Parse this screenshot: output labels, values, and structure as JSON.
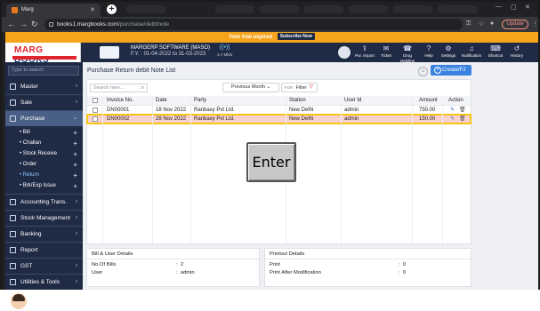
{
  "browser": {
    "tab_title": "Marg",
    "url_host": "books1.margbooks.com",
    "url_path": "/purchase/debitnote",
    "update_label": "Update"
  },
  "trial": {
    "text": "Your trial expired",
    "subscribe_label": "Subscribe Now"
  },
  "brand": {
    "logo_text_1": "MARG",
    "logo_text_2": "BOOKS"
  },
  "company": {
    "name": "MARGERP SOFTWARE (MASO)",
    "fy": "F.Y. : 01-04-2022 to 31-03-2023",
    "speed": "4.7 Mb/s"
  },
  "header_items": [
    {
      "label": "Pur. Import",
      "icon": "upload-icon"
    },
    {
      "label": "Ticket",
      "icon": "ticket-icon"
    },
    {
      "label": "Drug Helpline",
      "icon": "phone-icon"
    },
    {
      "label": "Help",
      "icon": "help-icon"
    },
    {
      "label": "Settings",
      "icon": "gear-icon"
    },
    {
      "label": "Notification",
      "icon": "bell-icon"
    },
    {
      "label": "Shortcut",
      "icon": "keyboard-icon"
    },
    {
      "label": "History",
      "icon": "history-icon"
    }
  ],
  "sidebar": {
    "search_placeholder": "Type to search",
    "items": [
      {
        "label": "Master"
      },
      {
        "label": "Sale"
      },
      {
        "label": "Purchase"
      },
      {
        "label": "Accounting Trans."
      },
      {
        "label": "Stock Management"
      },
      {
        "label": "Banking"
      },
      {
        "label": "Report"
      },
      {
        "label": "GST"
      },
      {
        "label": "Utilities & Tools"
      }
    ],
    "sub_items": [
      {
        "label": "Bill"
      },
      {
        "label": "Challan"
      },
      {
        "label": "Stock Receive"
      },
      {
        "label": "Order"
      },
      {
        "label": "Return"
      },
      {
        "label": "Brk/Exp Issue"
      }
    ]
  },
  "main": {
    "title": "Purchase Return debit Note List",
    "create_label": "Create/F2",
    "search_placeholder": "Search here...",
    "month_label": "Previous Month",
    "filter_tag": "FOR",
    "filter_label": "Filter",
    "columns": [
      "Invoice No.",
      "Date",
      "Party",
      "Station",
      "User Id",
      "Amount",
      "Action"
    ],
    "rows": [
      {
        "invoice": "DN00001",
        "date": "18 Nov 2022",
        "party": "Ranbaxy Pvt Ltd.",
        "station": "New Delhi",
        "user": "admin",
        "amount": "750.00"
      },
      {
        "invoice": "DN00002",
        "date": "28 Nov 2022",
        "party": "Ranbaxy Pvt Ltd.",
        "station": "New Delhi",
        "user": "admin",
        "amount": "150.00"
      }
    ]
  },
  "details": {
    "bill_user": {
      "heading": "Bill & User Details",
      "no_of_bills_label": "No.Of Bills",
      "no_of_bills_value": "2",
      "user_label": "User",
      "user_value": "admin"
    },
    "printout": {
      "heading": "Printout Details",
      "print_label": "Print",
      "print_value": "0",
      "print_after_label": "Print After Modification",
      "print_after_value": "0"
    }
  },
  "overlay": {
    "key_label": "Enter"
  }
}
